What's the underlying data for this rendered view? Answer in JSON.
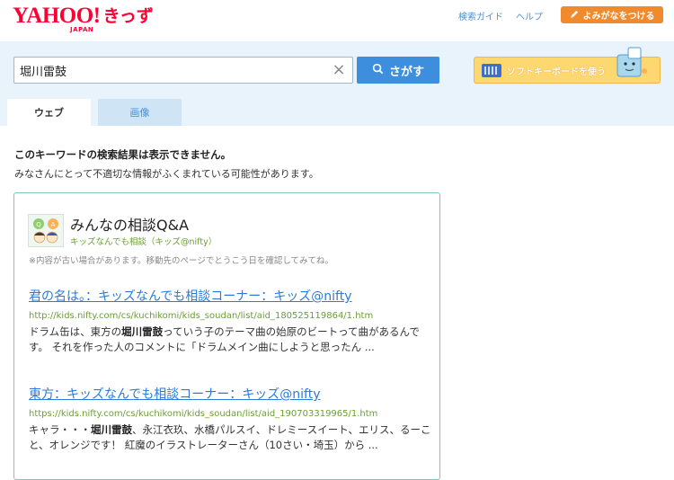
{
  "logo": {
    "yahoo": "YAHOO!",
    "kids": "きっず",
    "japan": "JAPAN"
  },
  "header": {
    "links": [
      "検索ガイド",
      "ヘルプ"
    ],
    "yomigana_button": "よみがなをつける"
  },
  "search": {
    "query": "堀川雷鼓",
    "clear_icon": "×",
    "button_label": "さがす",
    "soft_keyboard_label": "ソフトキーボードを使う"
  },
  "tabs": [
    {
      "label": "ウェブ",
      "active": true
    },
    {
      "label": "画像",
      "active": false
    }
  ],
  "notice": {
    "title": "このキーワードの検索結果は表示できません。",
    "description": "みなさんにとって不適切な情報がふくまれている可能性があります。"
  },
  "card": {
    "title": "みんなの相談Q&A",
    "subtitle": "キッズなんでも相談（キッズ@nifty）",
    "note": "※内容が古い場合があります。移動先のページでとうこう日を確認してみてね。",
    "results": [
      {
        "title": "君の名は。：キッズなんでも相談コーナー：キッズ@nifty",
        "url": "http://kids.nifty.com/cs/kuchikomi/kids_soudan/list/aid_180525119864/1.htm",
        "snippet_pre": "ドラム缶は、東方の",
        "snippet_bold": "堀川雷鼓",
        "snippet_post": "っていう子のテーマ曲の始原のビートって曲があるんです。 それを作った人のコメントに「ドラムメイン曲にしようと思ったん ..."
      },
      {
        "title": "東方：キッズなんでも相談コーナー：キッズ@nifty",
        "url": "https://kids.nifty.com/cs/kuchikomi/kids_soudan/list/aid_190703319965/1.htm",
        "snippet_pre": "キャラ・・・",
        "snippet_bold": "堀川雷鼓",
        "snippet_post": "、永江衣玖、水橋パルスイ、ドレミースイート、エリス、るーこと、オレンジです！ 紅魔のイラストレーターさん（10さい・埼玉）から ..."
      }
    ]
  },
  "colors": {
    "brand_red": "#ff0033",
    "link_blue": "#2c7ad9",
    "url_green": "#6aa033",
    "orange": "#f08a2c"
  }
}
